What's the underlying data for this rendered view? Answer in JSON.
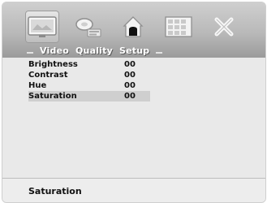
{
  "menu": {
    "icons": [
      {
        "name": "video-icon",
        "active": true
      },
      {
        "name": "audio-icon",
        "active": false
      },
      {
        "name": "parental-lock-icon",
        "active": false
      },
      {
        "name": "preferences-icon",
        "active": false
      },
      {
        "name": "exit-icon",
        "active": false
      }
    ],
    "tabs": [
      "Video",
      "Quality",
      "Setup"
    ]
  },
  "settings": {
    "items": [
      {
        "label": "Brightness",
        "value": "00"
      },
      {
        "label": "Contrast",
        "value": "00"
      },
      {
        "label": "Hue",
        "value": "00"
      },
      {
        "label": "Saturation",
        "value": "00"
      }
    ],
    "selected_label": "Saturation"
  },
  "footer": {
    "text": "Saturation"
  },
  "colors": {
    "background": "#ececec",
    "topbar": "#b9b9b9",
    "selection": "#cfcfcf",
    "text": "#111111"
  }
}
